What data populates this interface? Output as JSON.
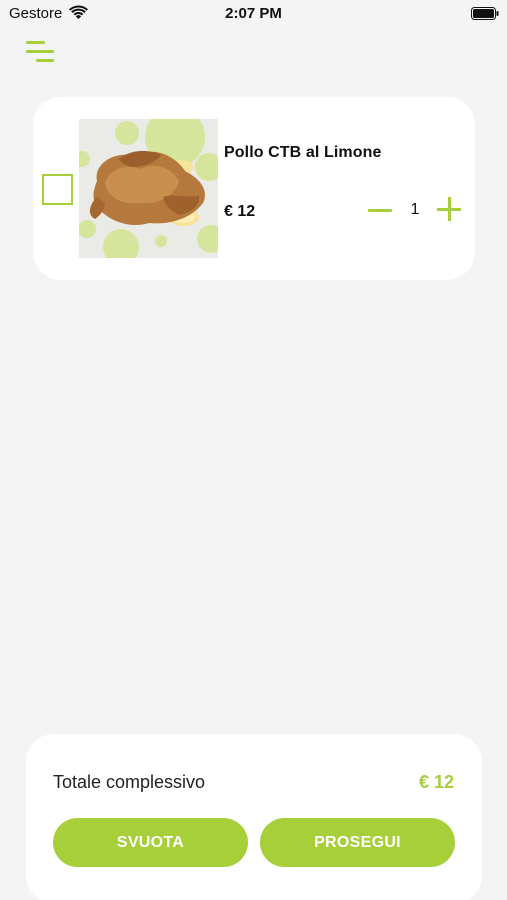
{
  "status_bar": {
    "carrier": "Gestore",
    "time": "2:07 PM",
    "icons": [
      "wifi-icon",
      "battery-icon"
    ]
  },
  "header": {
    "menu_icon": "menu-icon"
  },
  "cart": {
    "items": [
      {
        "name": "Pollo CTB al Limone",
        "price": "€ 12",
        "quantity": "1",
        "image": "roast-chicken-with-lemon"
      }
    ]
  },
  "footer": {
    "total_label": "Totale complessivo",
    "total_value": "€ 12",
    "empty_button": "SVUOTA",
    "continue_button": "PROSEGUI"
  },
  "colors": {
    "accent": "#a6cf3a",
    "background": "#f4f4f4",
    "card": "#ffffff"
  }
}
